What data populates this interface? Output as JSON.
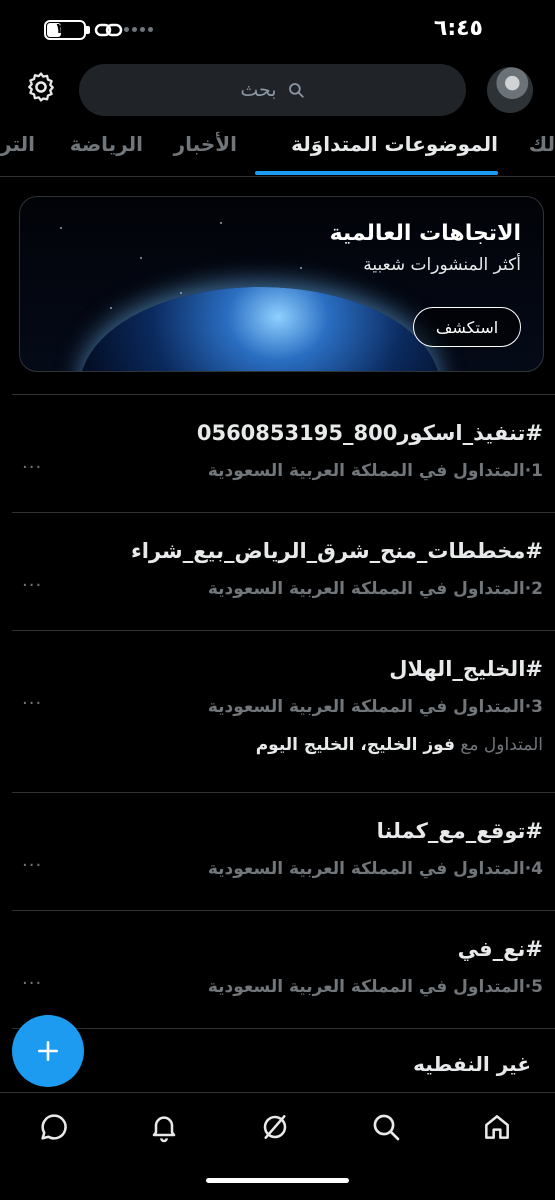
{
  "status_bar": {
    "time": "٦:٤٥",
    "battery_text": "٣٧",
    "battery_level_percent": 37
  },
  "search": {
    "placeholder": "بحث"
  },
  "tabs": [
    {
      "label": "لك",
      "active": false
    },
    {
      "label": "الموضوعات المتداوَلة",
      "active": true
    },
    {
      "label": "الأخبار",
      "active": false
    },
    {
      "label": "الرياضة",
      "active": false
    },
    {
      "label": "التر",
      "active": false
    }
  ],
  "banner": {
    "title": "الاتجاهات العالمية",
    "subtitle": "أكثر المنشورات شعبية",
    "button_label": "استكشف"
  },
  "trends": [
    {
      "title": "#تنفيذ_اسكور800_0560853195",
      "meta": "1·المتداول في المملكة العربية السعودية",
      "extra_prefix": "",
      "extra_bold": ""
    },
    {
      "title": "#مخططات_منح_شرق_الرياض_بيع_شراء",
      "meta": "2·المتداول في المملكة العربية السعودية",
      "extra_prefix": "",
      "extra_bold": ""
    },
    {
      "title": "#الخليج_الهلال",
      "meta": "3·المتداول في المملكة العربية السعودية",
      "extra_prefix": "المتداول مع",
      "extra_bold": "فوز الخليج، الخليج اليوم"
    },
    {
      "title": "#توقع_مع_كملنا",
      "meta": "4·المتداول في المملكة العربية السعودية",
      "extra_prefix": "",
      "extra_bold": ""
    },
    {
      "title": "#نع_في",
      "meta": "5·المتداول في المملكة العربية السعودية",
      "extra_prefix": "",
      "extra_bold": ""
    }
  ],
  "partial_item": "غير النفطيه",
  "more_label": "···",
  "fab_icon": "plus-icon",
  "nav": [
    "home-icon",
    "search-icon",
    "grok-icon",
    "notifications-icon",
    "messages-icon"
  ],
  "colors": {
    "accent": "#1d9bf0",
    "background": "#000000",
    "secondary_text": "#71767b"
  }
}
